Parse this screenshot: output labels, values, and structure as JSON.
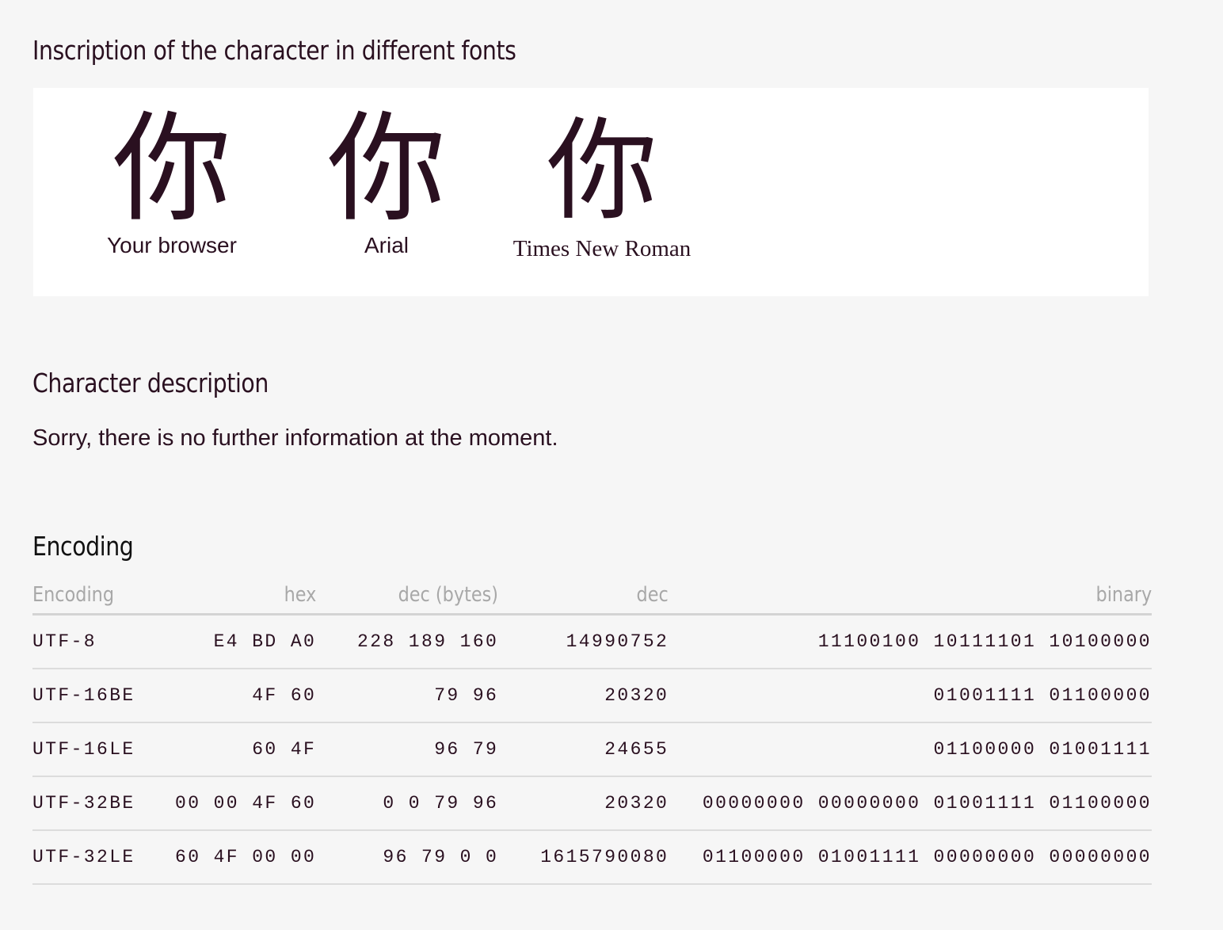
{
  "fonts_section": {
    "title": "Inscription of the character in different fonts",
    "character": "你",
    "samples": [
      {
        "label": "Your browser"
      },
      {
        "label": "Arial"
      },
      {
        "label": "Times New Roman"
      }
    ]
  },
  "description_section": {
    "title": "Character description",
    "text": "Sorry, there is no further information at the moment."
  },
  "encoding_section": {
    "title": "Encoding",
    "headers": {
      "encoding": "Encoding",
      "hex": "hex",
      "dec_bytes": "dec (bytes)",
      "dec": "dec",
      "binary": "binary"
    },
    "rows": [
      {
        "encoding": "UTF-8",
        "hex": "E4 BD A0",
        "dec_bytes": "228 189 160",
        "dec": "14990752",
        "binary": "11100100 10111101 10100000"
      },
      {
        "encoding": "UTF-16BE",
        "hex": "4F 60",
        "dec_bytes": "79 96",
        "dec": "20320",
        "binary": "01001111 01100000"
      },
      {
        "encoding": "UTF-16LE",
        "hex": "60 4F",
        "dec_bytes": "96 79",
        "dec": "24655",
        "binary": "01100000 01001111"
      },
      {
        "encoding": "UTF-32BE",
        "hex": "00 00 4F 60",
        "dec_bytes": "0 0 79 96",
        "dec": "20320",
        "binary": "00000000 00000000 01001111 01100000"
      },
      {
        "encoding": "UTF-32LE",
        "hex": "60 4F 00 00",
        "dec_bytes": "96 79 0 0",
        "dec": "1615790080",
        "binary": "01100000 01001111 00000000 00000000"
      }
    ]
  }
}
